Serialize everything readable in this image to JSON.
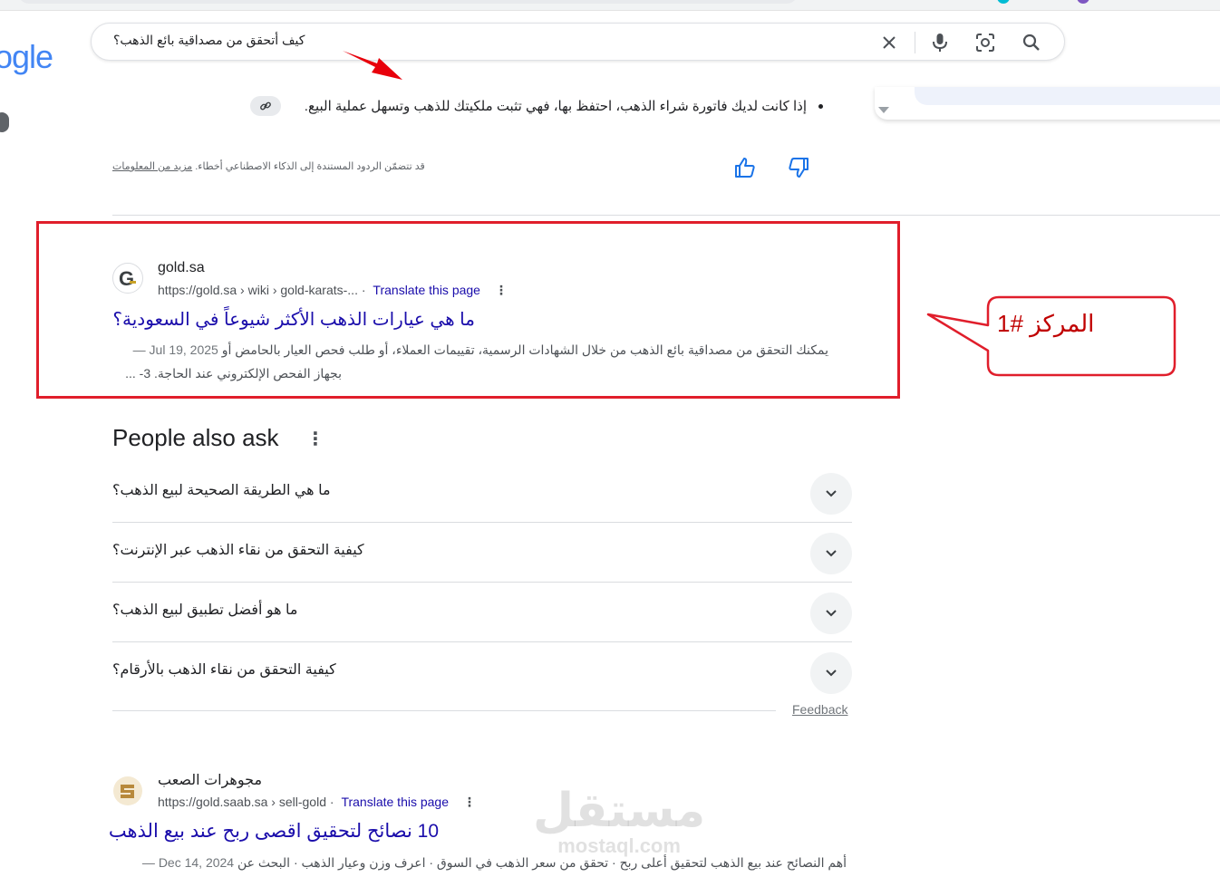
{
  "header": {
    "logo_text": "ogle",
    "search_query": "كيف أتحقق من مصداقية بائع الذهب؟"
  },
  "ai_overview": {
    "bullet_text": "إذا كانت لديك فاتورة شراء الذهب، احتفظ بها، فهي تثبت ملكيتك للذهب وتسهل عملية البيع.",
    "disclaimer_text": "قد تتضمّن الردود المستندة إلى الذكاء الاصطناعي أخطاء.",
    "disclaimer_link": "مزيد من المعلومات"
  },
  "results": [
    {
      "site_name": "gold.sa",
      "url": "https://gold.sa › wiki › gold-karats-...",
      "translate_label": "Translate this page",
      "title": "ما هي عيارات الذهب الأكثر شيوعاً في السعودية؟",
      "snippet_line1": "يمكنك التحقق من مصداقية بائع الذهب من خلال الشهادات الرسمية، تقييمات العملاء، أو طلب فحص العيار بالحامض أو",
      "date": "Jul 19, 2025 —",
      "snippet_line2": "بجهاز الفحص الإلكتروني عند الحاجة. 3- ..."
    },
    {
      "site_name": "مجوهرات الصعب",
      "url": "https://gold.saab.sa › sell-gold",
      "translate_label": "Translate this page",
      "title": "10 نصائح لتحقيق اقصى ربح عند بيع الذهب",
      "snippet_line1": "أهم النصائح عند بيع الذهب لتحقيق أعلى ربح · تحقق من سعر الذهب في السوق · اعرف وزن وعيار الذهب · البحث عن",
      "date": "Dec 14, 2024 —"
    }
  ],
  "callout": {
    "text": "المركز #1"
  },
  "people_also_ask": {
    "title": "People also ask",
    "questions": [
      "ما هي الطريقة الصحيحة لبيع الذهب؟",
      "كيفية التحقق من نقاء الذهب عبر الإنترنت؟",
      "ما هو أفضل تطبيق لبيع الذهب؟",
      "كيفية التحقق من نقاء الذهب بالأرقام؟"
    ],
    "feedback_label": "Feedback"
  },
  "watermark": {
    "line1": "مستقل",
    "line2": "mostaql.com"
  },
  "colors": {
    "link": "#1a0dab",
    "highlight_red": "#e01e2b",
    "callout_red": "#c00000"
  }
}
